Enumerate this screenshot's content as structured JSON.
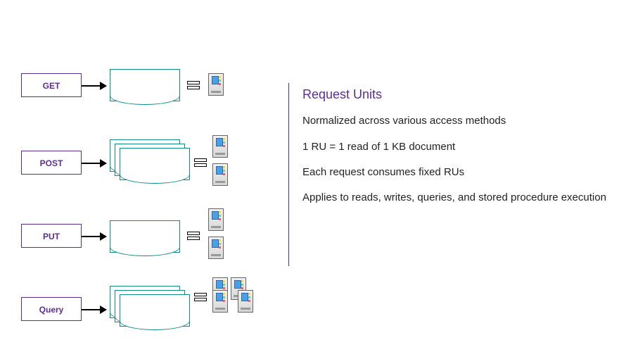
{
  "ops": {
    "get": "GET",
    "post": "POST",
    "put": "PUT",
    "query": "Query"
  },
  "text": {
    "heading": "Request Units",
    "line1": "Normalized across various access methods",
    "line2": "1 RU = 1 read of 1 KB document",
    "line3": "Each request consumes fixed RUs",
    "line4": "Applies to reads, writes, queries, and stored procedure execution"
  }
}
